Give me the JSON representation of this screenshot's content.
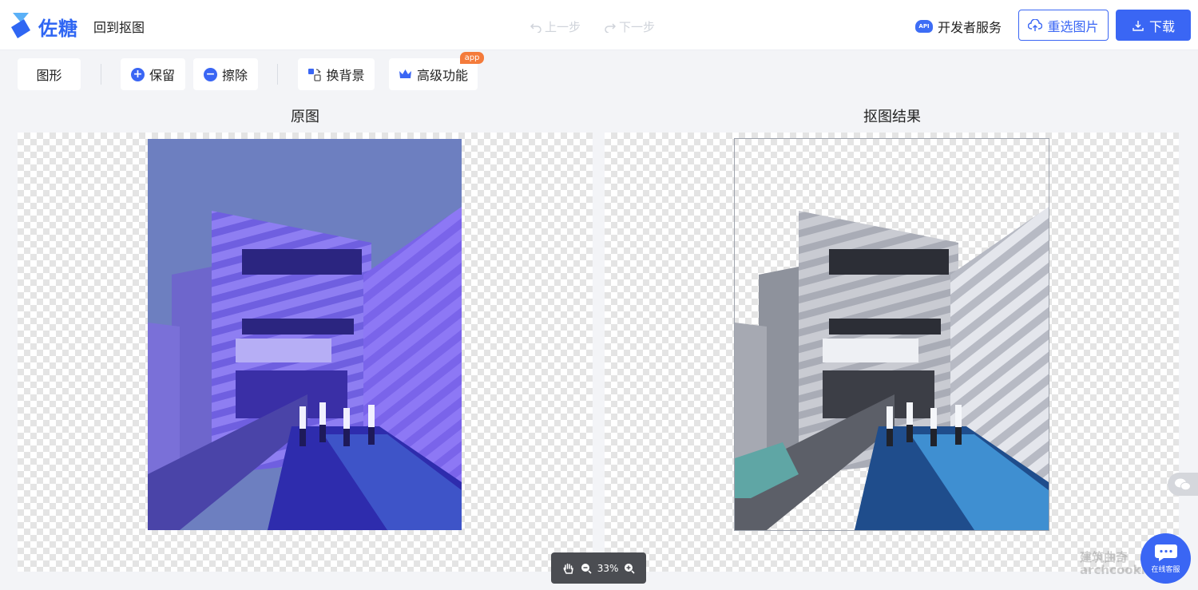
{
  "header": {
    "brand": "佐糖",
    "back_label": "回到抠图",
    "undo_label": "上一步",
    "redo_label": "下一步",
    "api_badge": "API",
    "dev_label": "开发者服务",
    "reselect_label": "重选图片",
    "download_label": "下载"
  },
  "toolbar": {
    "shape_label": "图形",
    "keep_label": "保留",
    "erase_label": "擦除",
    "bg_label": "换背景",
    "advanced_label": "高级功能",
    "app_tag": "app"
  },
  "panels": {
    "original_title": "原图",
    "result_title": "抠图结果"
  },
  "zoom": {
    "level": "33%"
  },
  "support": {
    "label": "在线客服"
  },
  "watermark": {
    "line1": "建筑曲奇",
    "line2": "archcookie"
  },
  "colors": {
    "accent": "#3a66f4",
    "app_tag": "#f47b3b",
    "zoom_bar": "#4b4d52"
  }
}
